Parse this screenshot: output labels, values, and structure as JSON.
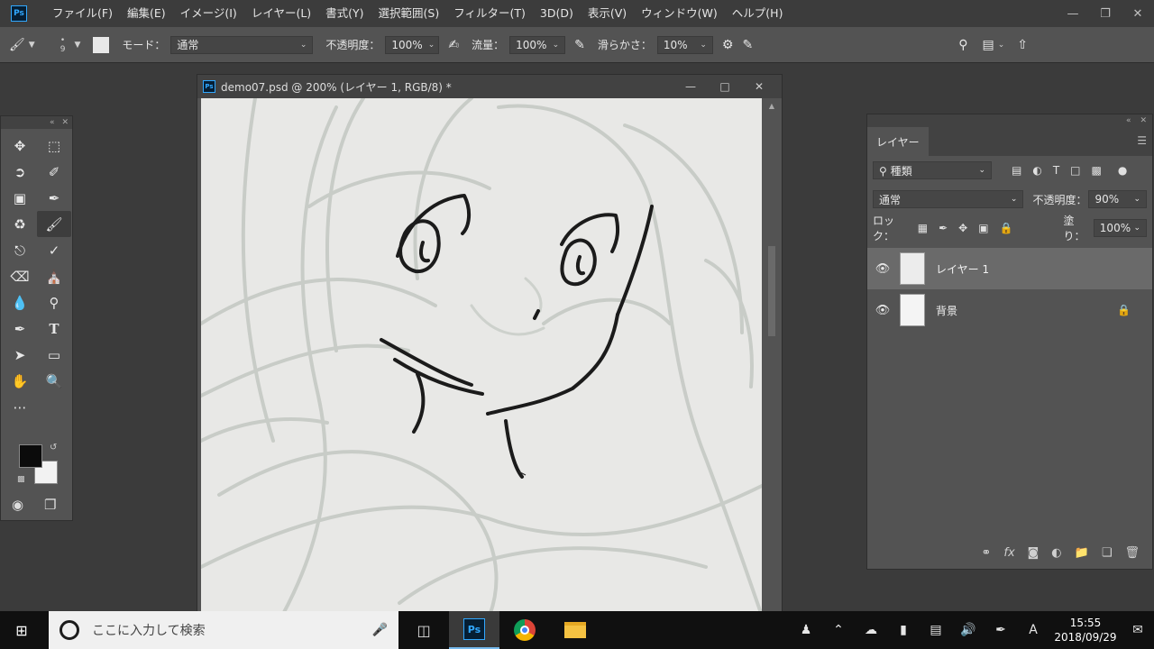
{
  "app": {
    "logo": "Ps"
  },
  "menu": [
    "ファイル(F)",
    "編集(E)",
    "イメージ(I)",
    "レイヤー(L)",
    "書式(Y)",
    "選択範囲(S)",
    "フィルター(T)",
    "3D(D)",
    "表示(V)",
    "ウィンドウ(W)",
    "ヘルプ(H)"
  ],
  "options": {
    "brush_size": "9",
    "mode_label": "モード：",
    "mode_value": "通常",
    "opacity_label": "不透明度：",
    "opacity_value": "100%",
    "flow_label": "流量：",
    "flow_value": "100%",
    "smoothing_label": "滑らかさ：",
    "smoothing_value": "10%"
  },
  "document": {
    "title": "demo07.psd @ 200% (レイヤー 1, RGB/8) *"
  },
  "layers_panel": {
    "tab": "レイヤー",
    "filter_kind": "種類",
    "blend_mode": "通常",
    "opacity_label": "不透明度：",
    "opacity_value": "90%",
    "lock_label": "ロック：",
    "fill_label": "塗り：",
    "fill_value": "100%",
    "layers": [
      {
        "name": "レイヤー 1",
        "selected": true,
        "locked": false
      },
      {
        "name": "背景",
        "selected": false,
        "locked": true
      }
    ]
  },
  "taskbar": {
    "search_placeholder": "ここに入力して検索",
    "time": "15:55",
    "date": "2018/09/29",
    "ime": "A"
  },
  "colors": {
    "foreground": "#0b0b0b",
    "background": "#f2f2f2",
    "accent": "#31a8ff"
  }
}
